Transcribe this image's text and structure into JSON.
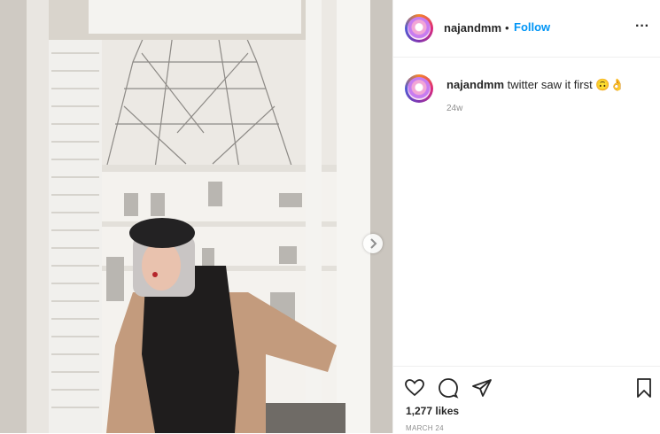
{
  "post": {
    "author": "najandmm",
    "follow_label": "Follow",
    "separator": "•",
    "more_label": "···",
    "caption": {
      "username": "najandmm",
      "text": "twitter saw it first 🙃👌",
      "age": "24w"
    },
    "likes": "1,277 likes",
    "date": "MARCH 24"
  },
  "icons": [
    "heart-icon",
    "comment-icon",
    "share-icon",
    "bookmark-icon",
    "next-arrow-icon",
    "more-options-icon"
  ]
}
